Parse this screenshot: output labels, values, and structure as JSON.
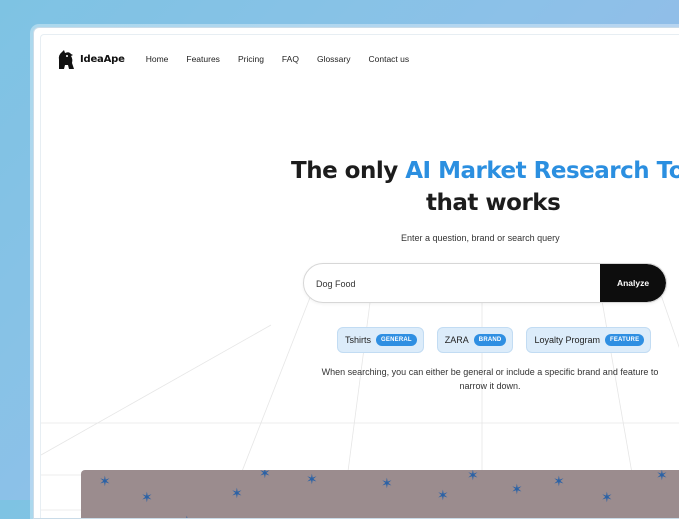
{
  "nav": {
    "brand": "IdeaApe",
    "items": [
      "Home",
      "Features",
      "Pricing",
      "FAQ",
      "Glossary",
      "Contact us"
    ]
  },
  "hero": {
    "title_prefix": "The only ",
    "title_accent": "AI Market Research Tool",
    "title_line2": "that works",
    "subtitle": "Enter a question, brand or search query"
  },
  "search": {
    "value": "Dog Food",
    "button_label": "Analyze"
  },
  "chips": [
    {
      "label": "Tshirts",
      "badge": "GENERAL"
    },
    {
      "label": "ZARA",
      "badge": "BRAND"
    },
    {
      "label": "Loyalty Program",
      "badge": "FEATURE"
    }
  ],
  "hint_line1": "When searching, you can either be general or include a specific brand and feature to",
  "hint_line2": "narrow it down.",
  "colors": {
    "accent": "#2b8fe0",
    "button": "#0d0d0d",
    "chip_bg": "#dcecfa",
    "badge": "#2f8fe2",
    "banner": "#9b8c8e",
    "star": "#2b62a6"
  }
}
